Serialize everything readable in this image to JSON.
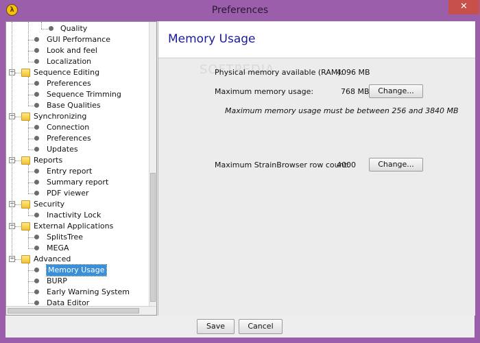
{
  "window": {
    "title": "Preferences",
    "app_icon_glyph": "λ",
    "close_glyph": "✕"
  },
  "tree": {
    "items": [
      {
        "label": "Quality",
        "type": "leaf"
      },
      {
        "label": "GUI Performance",
        "type": "leaf"
      },
      {
        "label": "Look and feel",
        "type": "leaf"
      },
      {
        "label": "Localization",
        "type": "leaf"
      },
      {
        "label": "Sequence Editing",
        "type": "folder"
      },
      {
        "label": "Preferences",
        "type": "leaf"
      },
      {
        "label": "Sequence Trimming",
        "type": "leaf"
      },
      {
        "label": "Base Qualities",
        "type": "leaf"
      },
      {
        "label": "Synchronizing",
        "type": "folder"
      },
      {
        "label": "Connection",
        "type": "leaf"
      },
      {
        "label": "Preferences",
        "type": "leaf"
      },
      {
        "label": "Updates",
        "type": "leaf"
      },
      {
        "label": "Reports",
        "type": "folder"
      },
      {
        "label": "Entry report",
        "type": "leaf"
      },
      {
        "label": "Summary report",
        "type": "leaf"
      },
      {
        "label": "PDF viewer",
        "type": "leaf"
      },
      {
        "label": "Security",
        "type": "folder"
      },
      {
        "label": "Inactivity Lock",
        "type": "leaf"
      },
      {
        "label": "External Applications",
        "type": "folder"
      },
      {
        "label": "SplitsTree",
        "type": "leaf"
      },
      {
        "label": "MEGA",
        "type": "leaf"
      },
      {
        "label": "Advanced",
        "type": "folder"
      },
      {
        "label": "Memory Usage",
        "type": "leaf",
        "selected": true
      },
      {
        "label": "BURP",
        "type": "leaf"
      },
      {
        "label": "Early Warning System",
        "type": "leaf"
      },
      {
        "label": "Data Editor",
        "type": "leaf"
      }
    ]
  },
  "panel": {
    "title": "Memory Usage",
    "watermark": "SOFTPEDIA",
    "physical_label": "Physical memory available (RAM):",
    "physical_value": "4096 MB",
    "max_label": "Maximum memory usage:",
    "max_value": "768 MB",
    "max_change": "Change...",
    "note": "Maximum memory usage must be between 256 and 3840 MB",
    "rows_label": "Maximum StrainBrowser row count:",
    "rows_value": "4000",
    "rows_change": "Change..."
  },
  "footer": {
    "save": "Save",
    "cancel": "Cancel"
  }
}
